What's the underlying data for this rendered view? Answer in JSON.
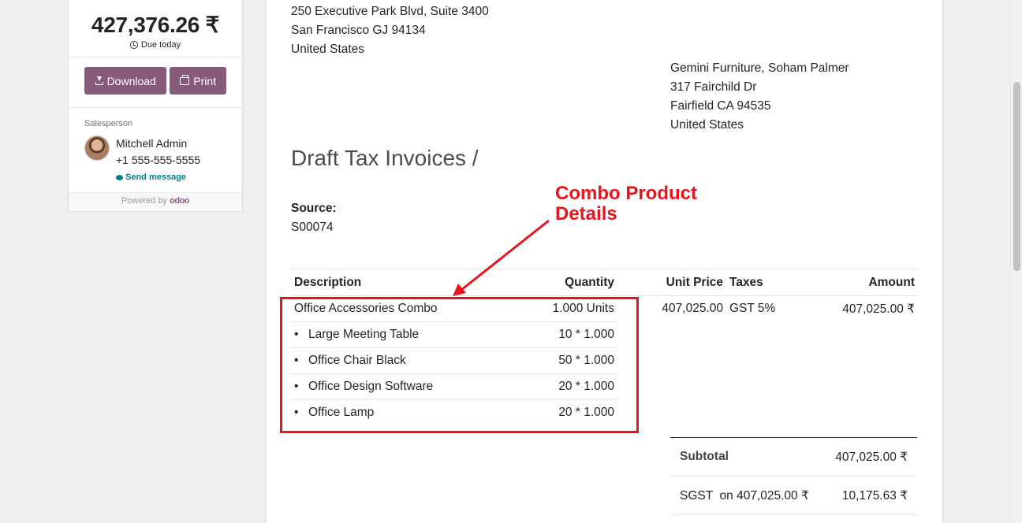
{
  "sidebar": {
    "amount": "427,376.26 ₹",
    "due_text": "Due today",
    "download_label": "Download",
    "print_label": "Print",
    "salesperson_label": "Salesperson",
    "salesperson_name": "Mitchell Admin",
    "salesperson_phone": "+1 555-555-5555",
    "send_message": "Send message",
    "powered_by": "Powered by",
    "powered_brand": "odoo"
  },
  "document": {
    "company_address": [
      "250 Executive Park Blvd, Suite 3400",
      "San Francisco GJ 94134",
      "United States"
    ],
    "partner_address": [
      "Gemini Furniture, Soham Palmer",
      "317 Fairchild Dr",
      "Fairfield CA 94535",
      "United States"
    ],
    "title": "Draft Tax Invoices /",
    "source_label": "Source:",
    "source_value": "S00074",
    "columns": [
      "Description",
      "Quantity",
      "Unit Price",
      "Taxes",
      "Amount"
    ],
    "main_line": {
      "description": "Office Accessories Combo",
      "quantity": "1.000 Units",
      "unit_price": "407,025.00",
      "taxes": "GST 5%",
      "amount": "407,025.00 ₹"
    },
    "combo_items": [
      {
        "bullet": "•",
        "description": "Large Meeting Table",
        "quantity": "10 * 1.000"
      },
      {
        "bullet": "•",
        "description": "Office Chair Black",
        "quantity": "50 * 1.000"
      },
      {
        "bullet": "•",
        "description": "Office Design Software",
        "quantity": "20 * 1.000"
      },
      {
        "bullet": "•",
        "description": "Office Lamp",
        "quantity": "20 * 1.000"
      }
    ],
    "totals": {
      "subtotal_label": "Subtotal",
      "subtotal_value": "407,025.00 ₹",
      "sgst_label": "SGST  on 407,025.00 ₹",
      "sgst_value": "10,175.63 ₹"
    }
  },
  "annotation": {
    "text_line1": "Combo Product",
    "text_line2": "Details",
    "color": "#e8141c"
  },
  "colors": {
    "brand": "#875a7b",
    "link": "#017e84"
  }
}
